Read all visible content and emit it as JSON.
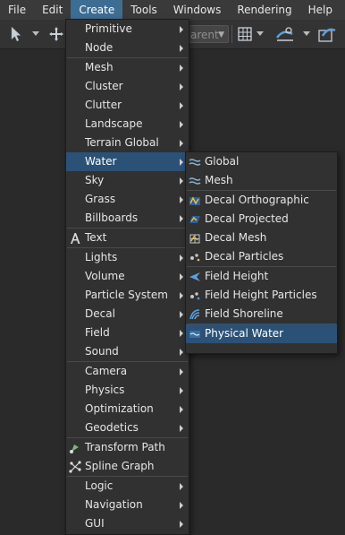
{
  "menubar": [
    "File",
    "Edit",
    "Create",
    "Tools",
    "Windows",
    "Rendering",
    "Help"
  ],
  "toolbar": {
    "combo_text": "arent"
  },
  "create_menu": {
    "groups": [
      [
        {
          "label": "Primitive",
          "sub": true
        },
        {
          "label": "Node",
          "sub": true
        }
      ],
      [
        {
          "label": "Mesh",
          "sub": true
        },
        {
          "label": "Cluster",
          "sub": true
        },
        {
          "label": "Clutter",
          "sub": true
        },
        {
          "label": "Landscape",
          "sub": true
        },
        {
          "label": "Terrain Global",
          "sub": true
        },
        {
          "label": "Water",
          "sub": true,
          "highlight": true
        },
        {
          "label": "Sky",
          "sub": true
        },
        {
          "label": "Grass",
          "sub": true
        },
        {
          "label": "Billboards",
          "sub": true
        }
      ],
      [
        {
          "label": "Text",
          "icon": "text-icon"
        }
      ],
      [
        {
          "label": "Lights",
          "sub": true
        },
        {
          "label": "Volume",
          "sub": true
        },
        {
          "label": "Particle System",
          "sub": true
        },
        {
          "label": "Decal",
          "sub": true
        },
        {
          "label": "Field",
          "sub": true
        },
        {
          "label": "Sound",
          "sub": true
        }
      ],
      [
        {
          "label": "Camera",
          "sub": true
        },
        {
          "label": "Physics",
          "sub": true
        },
        {
          "label": "Optimization",
          "sub": true
        },
        {
          "label": "Geodetics",
          "sub": true
        }
      ],
      [
        {
          "label": "Transform Path",
          "icon": "transform-path-icon"
        },
        {
          "label": "Spline Graph",
          "icon": "spline-graph-icon"
        }
      ],
      [
        {
          "label": "Logic",
          "sub": true
        },
        {
          "label": "Navigation",
          "sub": true
        },
        {
          "label": "GUI",
          "sub": true
        }
      ]
    ]
  },
  "water_submenu": {
    "groups": [
      [
        {
          "label": "Global",
          "icon": "water-global-icon"
        },
        {
          "label": "Mesh",
          "icon": "water-mesh-icon"
        }
      ],
      [
        {
          "label": "Decal Orthographic",
          "icon": "decal-orthographic-icon"
        },
        {
          "label": "Decal Projected",
          "icon": "decal-projected-icon"
        },
        {
          "label": "Decal Mesh",
          "icon": "decal-mesh-icon"
        },
        {
          "label": "Decal Particles",
          "icon": "decal-particles-icon"
        }
      ],
      [
        {
          "label": "Field Height",
          "icon": "field-height-icon"
        },
        {
          "label": "Field Height Particles",
          "icon": "field-height-particles-icon"
        },
        {
          "label": "Field Shoreline",
          "icon": "field-shoreline-icon"
        }
      ],
      [
        {
          "label": "Physical Water",
          "icon": "physical-water-icon",
          "highlight": true
        }
      ]
    ]
  },
  "colors": {
    "menubar_active": "#3e6d93",
    "row_highlight": "#2c5177",
    "icon_blue": "#5aa0e0"
  }
}
